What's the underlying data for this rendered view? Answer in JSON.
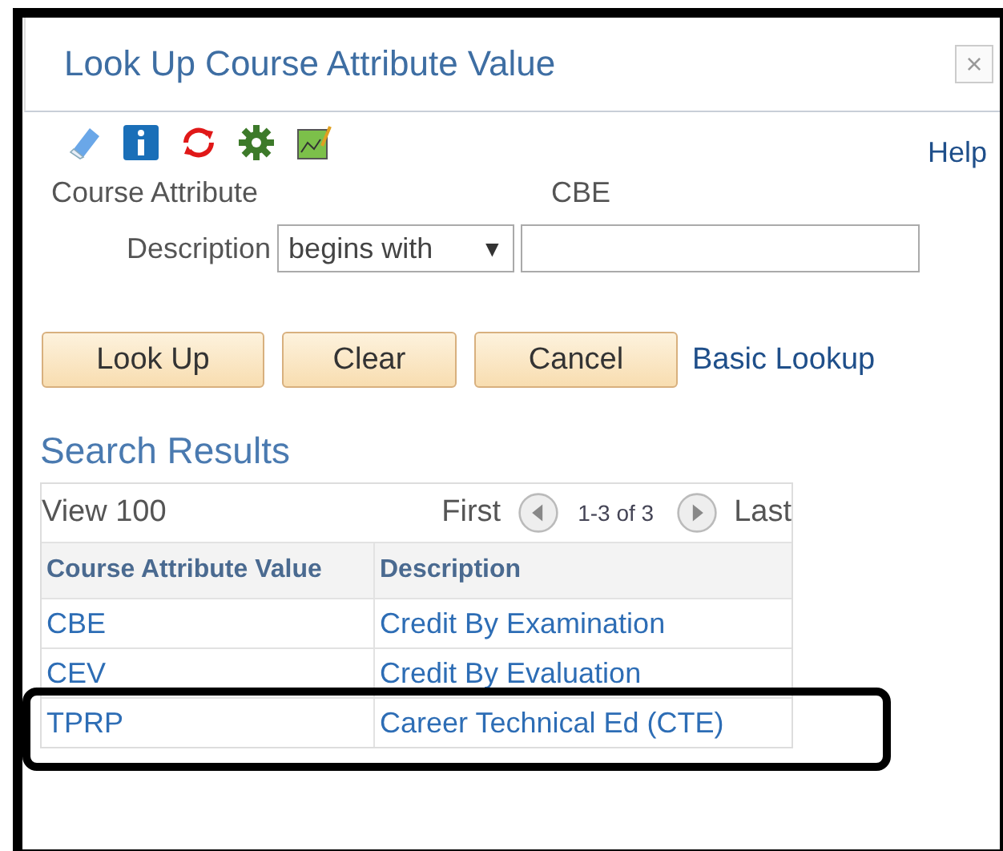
{
  "window": {
    "title": "Look Up Course Attribute Value",
    "close": "×"
  },
  "toolbar": {
    "help": "Help"
  },
  "form": {
    "attribute_label": "Course Attribute",
    "attribute_value": "CBE",
    "description_label": "Description",
    "operator": "begins with",
    "operator_caret": "▼"
  },
  "buttons": [
    "Look Up",
    "Clear",
    "Cancel"
  ],
  "basic_lookup": "Basic Lookup",
  "results": {
    "title": "Search Results",
    "view": "View 100",
    "first": "First",
    "range": "1-3 of 3",
    "last": "Last",
    "columns": [
      "Course Attribute Value",
      "Description"
    ],
    "rows": [
      {
        "value": "CBE",
        "description": "Credit By Examination",
        "highlighted": false
      },
      {
        "value": "CEV",
        "description": "Credit By Evaluation",
        "highlighted": false
      },
      {
        "value": "TPRP",
        "description": "Career Technical Ed (CTE)",
        "highlighted": true
      }
    ]
  }
}
